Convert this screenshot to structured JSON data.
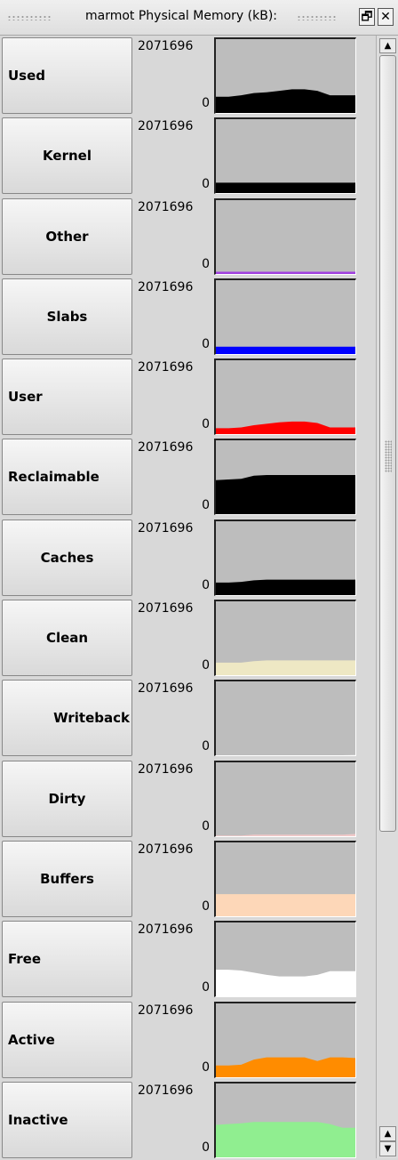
{
  "window": {
    "title": "marmot Physical Memory (kB):"
  },
  "icons": {
    "restore": "restore-window-icon",
    "close": "close-window-icon",
    "up": "scroll-up-arrow-icon",
    "down": "scroll-down-arrow-icon"
  },
  "meters": [
    {
      "label": "Used",
      "max": "2071696",
      "min": "0",
      "align": "left",
      "color": "#000000",
      "values": [
        0.22,
        0.22,
        0.24,
        0.27,
        0.28,
        0.3,
        0.32,
        0.32,
        0.3,
        0.24,
        0.24,
        0.24
      ]
    },
    {
      "label": "Kernel",
      "max": "2071696",
      "min": "0",
      "align": "center",
      "color": "#000000",
      "values": [
        0.14,
        0.14,
        0.14,
        0.14,
        0.14,
        0.14,
        0.14,
        0.14,
        0.14,
        0.14,
        0.14,
        0.14
      ]
    },
    {
      "label": "Other",
      "max": "2071696",
      "min": "0",
      "align": "center",
      "color": "#a040e0",
      "values": [
        0.03,
        0.03,
        0.03,
        0.03,
        0.03,
        0.03,
        0.03,
        0.03,
        0.03,
        0.03,
        0.03,
        0.03
      ]
    },
    {
      "label": "Slabs",
      "max": "2071696",
      "min": "0",
      "align": "center",
      "color": "#0000ff",
      "values": [
        0.1,
        0.1,
        0.1,
        0.1,
        0.1,
        0.1,
        0.1,
        0.1,
        0.1,
        0.1,
        0.1,
        0.1
      ]
    },
    {
      "label": "User",
      "max": "2071696",
      "min": "0",
      "align": "left",
      "color": "#ff0000",
      "values": [
        0.08,
        0.08,
        0.09,
        0.12,
        0.14,
        0.16,
        0.17,
        0.17,
        0.15,
        0.09,
        0.09,
        0.09
      ]
    },
    {
      "label": "Reclaimable",
      "max": "2071696",
      "min": "0",
      "align": "left",
      "color": "#000000",
      "values": [
        0.46,
        0.47,
        0.48,
        0.52,
        0.53,
        0.53,
        0.53,
        0.53,
        0.53,
        0.53,
        0.53,
        0.53
      ]
    },
    {
      "label": "Caches",
      "max": "2071696",
      "min": "0",
      "align": "center",
      "color": "#000000",
      "values": [
        0.17,
        0.17,
        0.18,
        0.2,
        0.21,
        0.21,
        0.21,
        0.21,
        0.21,
        0.21,
        0.21,
        0.21
      ]
    },
    {
      "label": "Clean",
      "max": "2071696",
      "min": "0",
      "align": "center",
      "color": "#eee8c4",
      "values": [
        0.17,
        0.17,
        0.17,
        0.19,
        0.2,
        0.2,
        0.2,
        0.2,
        0.2,
        0.2,
        0.2,
        0.2
      ]
    },
    {
      "label": "Writeback",
      "max": "2071696",
      "min": "0",
      "align": "right",
      "color": "#d0d0d0",
      "values": [
        0.0,
        0.0,
        0.0,
        0.0,
        0.0,
        0.0,
        0.0,
        0.0,
        0.0,
        0.0,
        0.0,
        0.01
      ]
    },
    {
      "label": "Dirty",
      "max": "2071696",
      "min": "0",
      "align": "center",
      "color": "#f0c8c8",
      "values": [
        0.01,
        0.01,
        0.01,
        0.02,
        0.02,
        0.02,
        0.02,
        0.02,
        0.02,
        0.02,
        0.02,
        0.03
      ]
    },
    {
      "label": "Buffers",
      "max": "2071696",
      "min": "0",
      "align": "center",
      "color": "#fdd7b8",
      "values": [
        0.3,
        0.3,
        0.3,
        0.3,
        0.3,
        0.3,
        0.3,
        0.3,
        0.3,
        0.3,
        0.3,
        0.3
      ]
    },
    {
      "label": "Free",
      "max": "2071696",
      "min": "0",
      "align": "left",
      "color": "#ffffff",
      "values": [
        0.36,
        0.36,
        0.35,
        0.32,
        0.29,
        0.27,
        0.27,
        0.27,
        0.29,
        0.34,
        0.34,
        0.34
      ]
    },
    {
      "label": "Active",
      "max": "2071696",
      "min": "0",
      "align": "left",
      "color": "#ff8c00",
      "values": [
        0.16,
        0.16,
        0.17,
        0.24,
        0.27,
        0.27,
        0.27,
        0.27,
        0.22,
        0.27,
        0.27,
        0.26
      ]
    },
    {
      "label": "Inactive",
      "max": "2071696",
      "min": "0",
      "align": "left",
      "color": "#90ee90",
      "values": [
        0.44,
        0.45,
        0.46,
        0.48,
        0.48,
        0.48,
        0.48,
        0.48,
        0.48,
        0.45,
        0.4,
        0.4
      ]
    }
  ]
}
